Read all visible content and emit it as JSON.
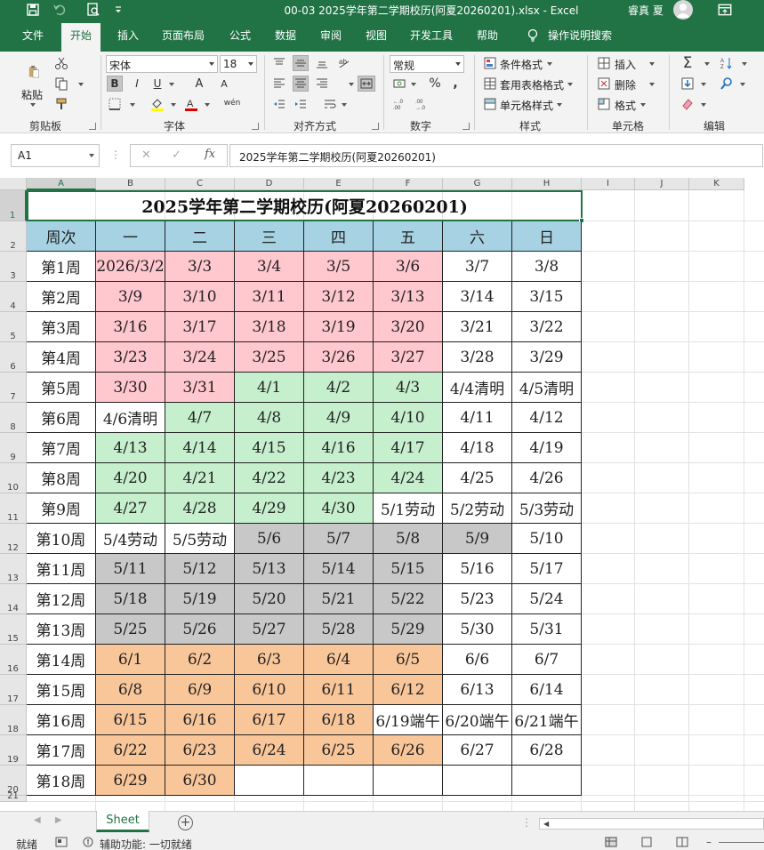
{
  "app": {
    "doc_title": "00-03 2025学年第二学期校历(阿夏20260201).xlsx  -  Excel",
    "user_name": "睿真 夏"
  },
  "tabs": [
    "文件",
    "开始",
    "插入",
    "页面布局",
    "公式",
    "数据",
    "审阅",
    "视图",
    "开发工具",
    "帮助"
  ],
  "active_tab": "开始",
  "tell_me": "操作说明搜索",
  "ribbon": {
    "clipboard": {
      "paste": "粘贴",
      "label": "剪贴板"
    },
    "font": {
      "name": "宋体",
      "size": "18",
      "label": "字体",
      "bold": "B",
      "italic": "I",
      "underline": "U",
      "grow": "A",
      "shrink": "A",
      "phonetic": "wén"
    },
    "alignment": {
      "label": "对齐方式"
    },
    "number": {
      "format": "常规",
      "label": "数字",
      "percent": "%",
      "comma": ","
    },
    "styles": {
      "conditional": "条件格式",
      "table": "套用表格格式",
      "cell": "单元格样式",
      "label": "样式"
    },
    "cells": {
      "insert": "插入",
      "delete": "删除",
      "format": "格式",
      "label": "单元格"
    },
    "editing": {
      "label": "编辑"
    }
  },
  "formula_bar": {
    "name_box": "A1",
    "content": "2025学年第二学期校历(阿夏20260201)"
  },
  "columns": [
    "A",
    "B",
    "C",
    "D",
    "E",
    "F",
    "G",
    "H",
    "I",
    "J",
    "K"
  ],
  "rows": [
    "1",
    "2",
    "3",
    "4",
    "5",
    "6",
    "7",
    "8",
    "9",
    "10",
    "11",
    "12",
    "13",
    "14",
    "15",
    "16",
    "17",
    "18",
    "19",
    "20",
    "21"
  ],
  "colors": {
    "accent": "#217346",
    "header": "#a6d2e3",
    "pink": "#ffc7ce",
    "green": "#c6efce",
    "gray": "#c8c8c8",
    "orange": "#f9c69a",
    "white": "#ffffff"
  },
  "calendar": {
    "title": "2025学年第二学期校历(阿夏20260201)",
    "headers": [
      "周次",
      "一",
      "二",
      "三",
      "四",
      "五",
      "六",
      "日"
    ],
    "weeks": [
      {
        "label": "第1周",
        "days": [
          "2026/3/2",
          "3/3",
          "3/4",
          "3/5",
          "3/6",
          "3/7",
          "3/8"
        ],
        "fills": [
          "pink",
          "pink",
          "pink",
          "pink",
          "pink",
          "white",
          "white"
        ]
      },
      {
        "label": "第2周",
        "days": [
          "3/9",
          "3/10",
          "3/11",
          "3/12",
          "3/13",
          "3/14",
          "3/15"
        ],
        "fills": [
          "pink",
          "pink",
          "pink",
          "pink",
          "pink",
          "white",
          "white"
        ]
      },
      {
        "label": "第3周",
        "days": [
          "3/16",
          "3/17",
          "3/18",
          "3/19",
          "3/20",
          "3/21",
          "3/22"
        ],
        "fills": [
          "pink",
          "pink",
          "pink",
          "pink",
          "pink",
          "white",
          "white"
        ]
      },
      {
        "label": "第4周",
        "days": [
          "3/23",
          "3/24",
          "3/25",
          "3/26",
          "3/27",
          "3/28",
          "3/29"
        ],
        "fills": [
          "pink",
          "pink",
          "pink",
          "pink",
          "pink",
          "white",
          "white"
        ]
      },
      {
        "label": "第5周",
        "days": [
          "3/30",
          "3/31",
          "4/1",
          "4/2",
          "4/3",
          "4/4清明",
          "4/5清明"
        ],
        "fills": [
          "pink",
          "pink",
          "green",
          "green",
          "green",
          "white",
          "white"
        ]
      },
      {
        "label": "第6周",
        "days": [
          "4/6清明",
          "4/7",
          "4/8",
          "4/9",
          "4/10",
          "4/11",
          "4/12"
        ],
        "fills": [
          "white",
          "green",
          "green",
          "green",
          "green",
          "white",
          "white"
        ]
      },
      {
        "label": "第7周",
        "days": [
          "4/13",
          "4/14",
          "4/15",
          "4/16",
          "4/17",
          "4/18",
          "4/19"
        ],
        "fills": [
          "green",
          "green",
          "green",
          "green",
          "green",
          "white",
          "white"
        ]
      },
      {
        "label": "第8周",
        "days": [
          "4/20",
          "4/21",
          "4/22",
          "4/23",
          "4/24",
          "4/25",
          "4/26"
        ],
        "fills": [
          "green",
          "green",
          "green",
          "green",
          "green",
          "white",
          "white"
        ]
      },
      {
        "label": "第9周",
        "days": [
          "4/27",
          "4/28",
          "4/29",
          "4/30",
          "5/1劳动",
          "5/2劳动",
          "5/3劳动"
        ],
        "fills": [
          "green",
          "green",
          "green",
          "green",
          "white",
          "white",
          "white"
        ]
      },
      {
        "label": "第10周",
        "days": [
          "5/4劳动",
          "5/5劳动",
          "5/6",
          "5/7",
          "5/8",
          "5/9",
          "5/10"
        ],
        "fills": [
          "white",
          "white",
          "gray",
          "gray",
          "gray",
          "gray",
          "white"
        ]
      },
      {
        "label": "第11周",
        "days": [
          "5/11",
          "5/12",
          "5/13",
          "5/14",
          "5/15",
          "5/16",
          "5/17"
        ],
        "fills": [
          "gray",
          "gray",
          "gray",
          "gray",
          "gray",
          "white",
          "white"
        ]
      },
      {
        "label": "第12周",
        "days": [
          "5/18",
          "5/19",
          "5/20",
          "5/21",
          "5/22",
          "5/23",
          "5/24"
        ],
        "fills": [
          "gray",
          "gray",
          "gray",
          "gray",
          "gray",
          "white",
          "white"
        ]
      },
      {
        "label": "第13周",
        "days": [
          "5/25",
          "5/26",
          "5/27",
          "5/28",
          "5/29",
          "5/30",
          "5/31"
        ],
        "fills": [
          "gray",
          "gray",
          "gray",
          "gray",
          "gray",
          "white",
          "white"
        ]
      },
      {
        "label": "第14周",
        "days": [
          "6/1",
          "6/2",
          "6/3",
          "6/4",
          "6/5",
          "6/6",
          "6/7"
        ],
        "fills": [
          "orange",
          "orange",
          "orange",
          "orange",
          "orange",
          "white",
          "white"
        ]
      },
      {
        "label": "第15周",
        "days": [
          "6/8",
          "6/9",
          "6/10",
          "6/11",
          "6/12",
          "6/13",
          "6/14"
        ],
        "fills": [
          "orange",
          "orange",
          "orange",
          "orange",
          "orange",
          "white",
          "white"
        ]
      },
      {
        "label": "第16周",
        "days": [
          "6/15",
          "6/16",
          "6/17",
          "6/18",
          "6/19端午",
          "6/20端午",
          "6/21端午"
        ],
        "fills": [
          "orange",
          "orange",
          "orange",
          "orange",
          "white",
          "white",
          "white"
        ]
      },
      {
        "label": "第17周",
        "days": [
          "6/22",
          "6/23",
          "6/24",
          "6/25",
          "6/26",
          "6/27",
          "6/28"
        ],
        "fills": [
          "orange",
          "orange",
          "orange",
          "orange",
          "orange",
          "white",
          "white"
        ]
      },
      {
        "label": "第18周",
        "days": [
          "6/29",
          "6/30",
          "",
          "",
          "",
          "",
          ""
        ],
        "fills": [
          "orange",
          "orange",
          "white",
          "white",
          "white",
          "white",
          "white"
        ]
      }
    ]
  },
  "sheet_tab": "Sheet",
  "status": {
    "ready": "就绪",
    "accessibility": "辅助功能: 一切就绪"
  }
}
